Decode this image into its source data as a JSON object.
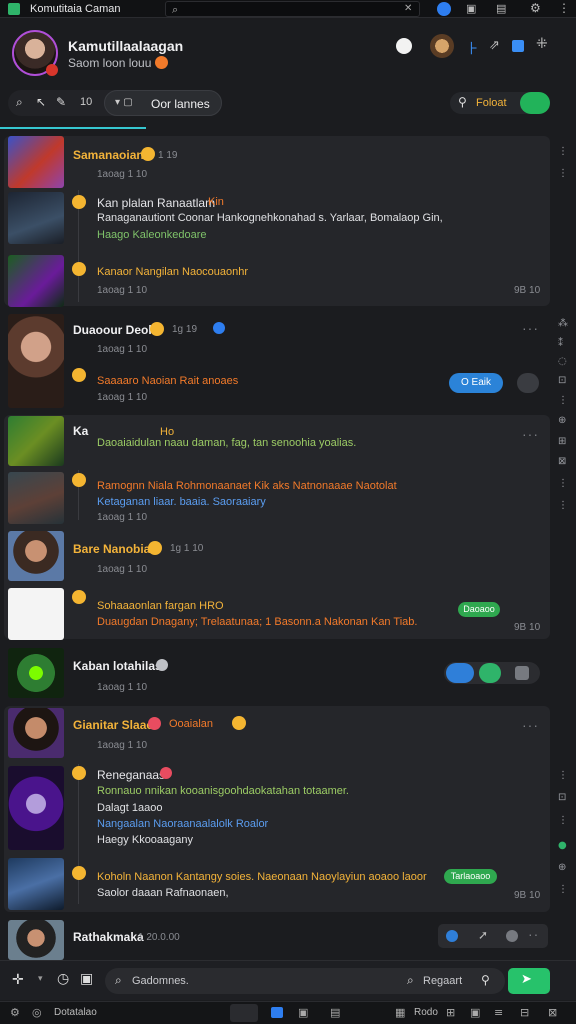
{
  "app": {
    "title": "Komutitaia Caman"
  },
  "profile": {
    "name": "Kamutillaalaagan",
    "status": "Saom loon louu"
  },
  "tabs": {
    "active_label": "Oor lannes",
    "counter": "10"
  },
  "filter": {
    "label": "Foloat"
  },
  "feed": [
    {
      "name": "Samanaoian",
      "meta": "1 19",
      "sub": "1aoag 1 10"
    },
    {
      "name": "Kan plalan Ranaatlam",
      "tag": "Kin",
      "line1": "Ranaganautiont Coonar Hankognehkonahad s. Yarlaar, Bomalaop Gin,",
      "line2": "Haago Kaleonkedoare"
    },
    {
      "name": "Kanaor Nangilan Naocouaonhr",
      "sub": "1aoag 1 10",
      "time": "9B 10"
    },
    {
      "name": "Duaoour Deole",
      "meta": "1g 19",
      "sub": "1aoag 1 10"
    },
    {
      "name": "Saaaaro Naoian Rait anoaes",
      "sub": "1aoag 1 10",
      "pill": "O Eaik"
    },
    {
      "name": "Ka",
      "tag": "Ho",
      "line1": "Daoaiaidulan naau daman, fag, tan senoohia yoalias.",
      "sub": ""
    },
    {
      "name": "Ramognn Niala Rohmonaanaet Kik aks Natnonaaae Naotolat",
      "line2": "Ketaganan liaar. baaia. Saoraaiary",
      "sub": "1aoag 1 10"
    },
    {
      "name": "Bare Nanobiae",
      "meta": "1g 1 10",
      "sub": "1aoag 1 10"
    },
    {
      "name": "Sohaaaonlan fargan HRO",
      "line2": "Duaugdan Dnagany; Trelaatunaa; 1 Basonn.a Nakonan Kan Tiab.",
      "pill": "Daoaoo",
      "time": "9B 10"
    },
    {
      "name": "Kaban lotahilas",
      "sub": "1aoag 1 10"
    },
    {
      "name": "Gianitar Slaae",
      "tag": "Ooaialan",
      "sub": "1aoag 1 10"
    },
    {
      "name": "Reneganaas",
      "line1": "Ronnauo nnikan kooanisgoohdaokatahan totaamer.",
      "line2": "Dalagt 1aaoo",
      "line3": "Nangaalan Naoraanaalalolk Roalor",
      "line4": "Haegy Kkooaagany"
    },
    {
      "name": "Koholn Naanon Kantangy soies. Naeonaan Naoylayiun aoaoo laoor",
      "line2": "Saolor daaan Rafnaonaen,",
      "pill": "Tarlaoaoo",
      "time": "9B 10"
    },
    {
      "name": "Rathakmaka",
      "meta": "1 20.0.00"
    }
  ],
  "composer": {
    "placeholder": "Gadomnes.",
    "search": "Regaart"
  },
  "statusbar": {
    "left": "Dotatalao",
    "right": "Rodo"
  }
}
